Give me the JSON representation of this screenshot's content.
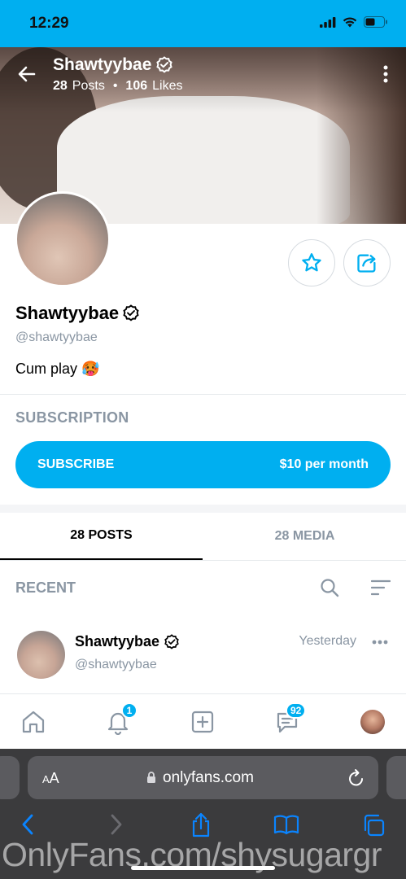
{
  "status_bar": {
    "time": "12:29",
    "icons": [
      "signal-icon",
      "wifi-icon",
      "battery-icon"
    ]
  },
  "header": {
    "name": "Shawtyybae",
    "posts_count": "28",
    "posts_label": "Posts",
    "separator": "•",
    "likes_count": "106",
    "likes_label": "Likes"
  },
  "profile": {
    "name": "Shawtyybae",
    "handle": "@shawtyybae",
    "bio": "Cum play 🥵"
  },
  "subscription": {
    "section_title": "SUBSCRIPTION",
    "button_label": "SUBSCRIBE",
    "price": "$10 per month"
  },
  "tabs": [
    {
      "label": "28 POSTS",
      "active": true
    },
    {
      "label": "28 MEDIA",
      "active": false
    }
  ],
  "feed": {
    "section_title": "RECENT"
  },
  "post": {
    "author_name": "Shawtyybae",
    "author_handle": "@shawtyybae",
    "time": "Yesterday"
  },
  "bottom_nav": {
    "notifications_badge": "1",
    "messages_badge": "92"
  },
  "browser": {
    "aa_label_small": "A",
    "aa_label_large": "A",
    "url": "onlyfans.com"
  },
  "watermark": "OnlyFans.com/shysugargr",
  "colors": {
    "accent": "#00aff0",
    "muted_text": "#8a96a3",
    "safari_bg": "#3b3b3d"
  }
}
